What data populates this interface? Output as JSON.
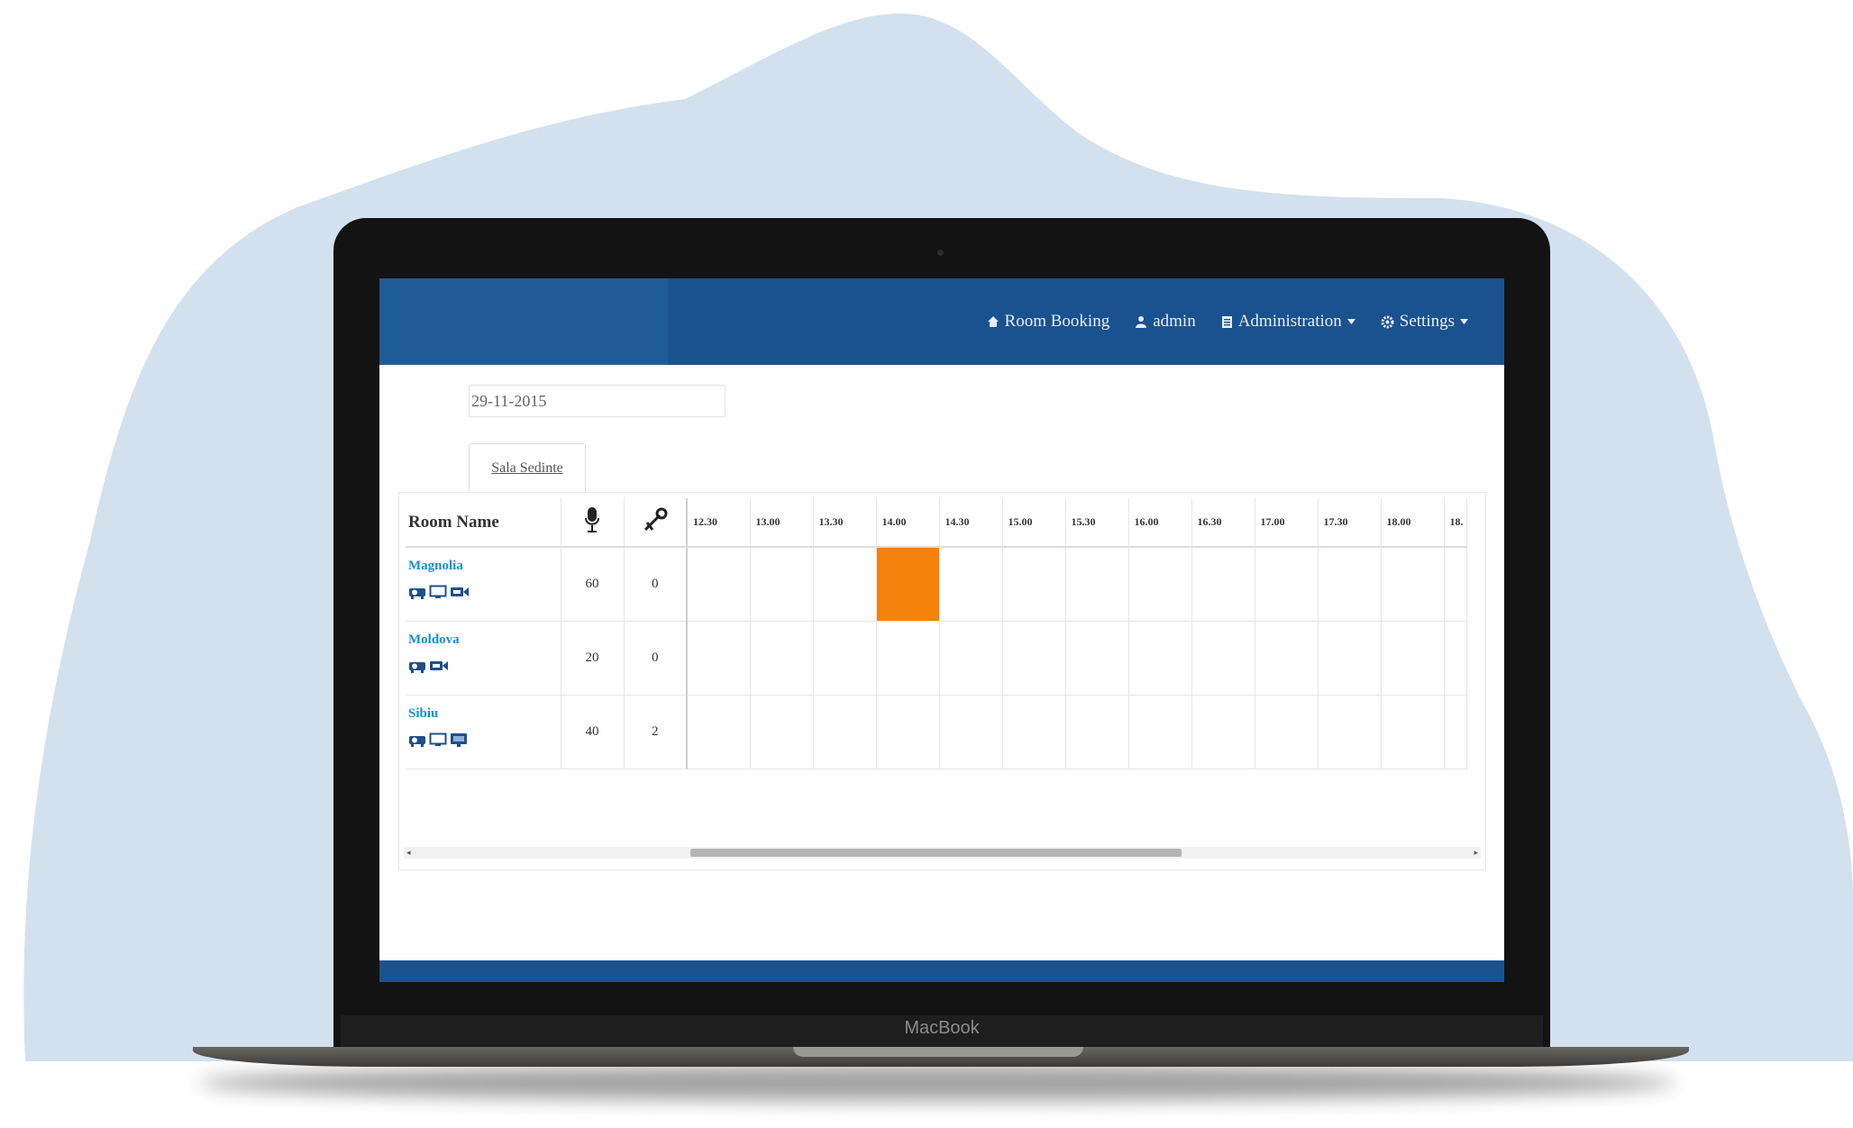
{
  "colors": {
    "background_blob": "#d3e1ee",
    "navbar": "#1a5290",
    "booked": "#f5820b",
    "room_link": "#1a8fd1"
  },
  "device": {
    "label": "MacBook"
  },
  "nav": {
    "items": [
      {
        "icon": "home-icon",
        "label": "Room Booking"
      },
      {
        "icon": "user-icon",
        "label": "admin"
      },
      {
        "icon": "document-icon",
        "label": "Administration"
      },
      {
        "icon": "gear-icon",
        "label": "Settings"
      }
    ]
  },
  "date_field": {
    "value": "29-11-2015"
  },
  "tab": {
    "label": "Sala Sedinte"
  },
  "table": {
    "room_header": "Room Name",
    "capacity_icon": "microphone-icon",
    "extra_icon": "tools-icon",
    "times": [
      "12.30",
      "13.00",
      "13.30",
      "14.00",
      "14.30",
      "15.00",
      "15.30",
      "16.00",
      "16.30",
      "17.00",
      "17.30",
      "18.00",
      "18."
    ],
    "rooms": [
      {
        "name": "Magnolia",
        "capacity": "60",
        "extra": "0",
        "amenities": [
          "projector-icon",
          "monitor-icon",
          "video-icon"
        ],
        "booked_slots": [
          "14.00"
        ]
      },
      {
        "name": "Moldova",
        "capacity": "20",
        "extra": "0",
        "amenities": [
          "projector-icon",
          "video-icon"
        ],
        "booked_slots": []
      },
      {
        "name": "Sibiu",
        "capacity": "40",
        "extra": "2",
        "amenities": [
          "projector-icon",
          "monitor-icon",
          "screen-icon"
        ],
        "booked_slots": []
      }
    ]
  },
  "scrollbar": {
    "left_arrow": "◂",
    "right_arrow": "▸"
  }
}
